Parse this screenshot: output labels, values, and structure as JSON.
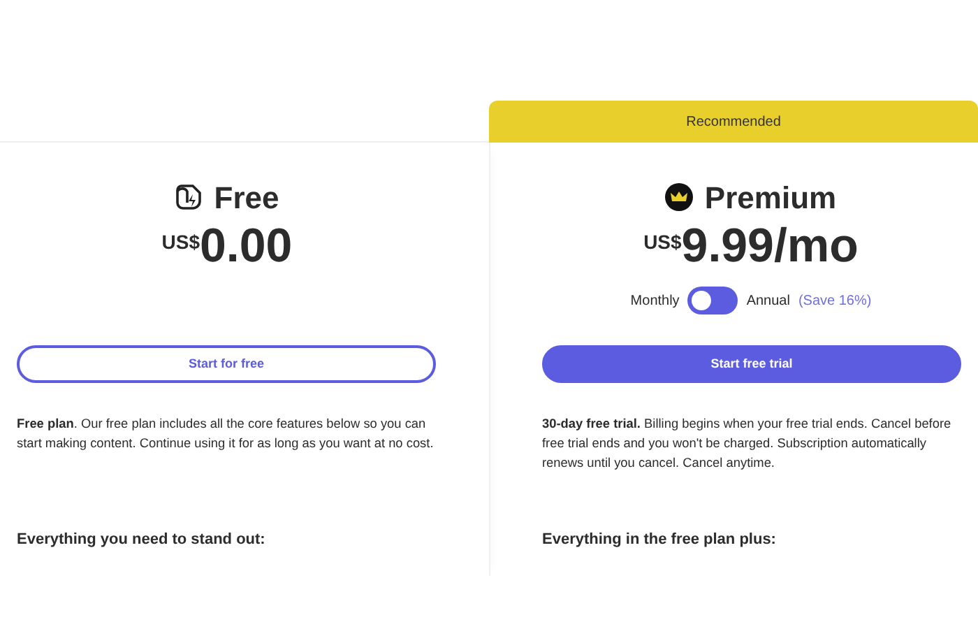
{
  "plans": [
    {
      "kind": "free",
      "name": "Free",
      "currency": "US$",
      "price": "0.00",
      "button": {
        "label": "Start for free",
        "primary": false
      },
      "description": "**Free plan**. Our free plan includes all the core features below so you can start making content. Continue using it for as long as you want at no cost.",
      "features_heading": "Everything you need to stand out:"
    },
    {
      "kind": "premium",
      "banner": "Recommended",
      "name": "Premium",
      "currency": "US$",
      "price": "9.99/mo",
      "billing_toggle": {
        "left_label": "Monthly",
        "right_label": "Annual",
        "saving": "(Save 16%)",
        "on": false
      },
      "button": {
        "label": "Start free trial",
        "primary": true
      },
      "description": "**30-day free trial.** Billing begins when your free trial ends. Cancel before free trial ends and you won't be charged. Subscription automatically renews until you cancel. Cancel anytime.",
      "features_heading": "Everything in the free plan plus:"
    }
  ]
}
